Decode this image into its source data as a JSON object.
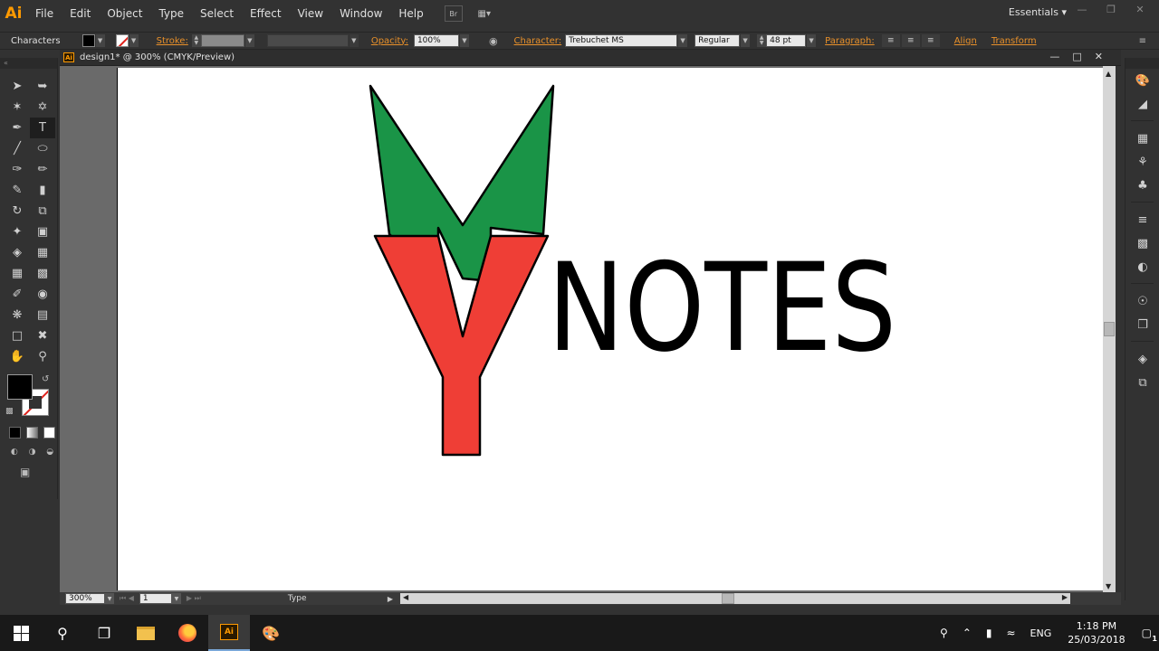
{
  "app": {
    "logo": "Ai"
  },
  "menu": {
    "items": [
      "File",
      "Edit",
      "Object",
      "Type",
      "Select",
      "Effect",
      "View",
      "Window",
      "Help"
    ],
    "bridge": "Br",
    "workspace": "Essentials"
  },
  "control": {
    "panel_label": "Characters",
    "stroke_label": "Stroke:",
    "opacity_label": "Opacity:",
    "opacity_value": "100%",
    "character_label": "Character:",
    "font_family": "Trebuchet MS",
    "font_style": "Regular",
    "font_size": "48 pt",
    "paragraph_label": "Paragraph:",
    "align_label": "Align",
    "transform_label": "Transform"
  },
  "document": {
    "title": "design1* @ 300% (CMYK/Preview)",
    "artwork_text": "NOTES",
    "colors": {
      "green": "#1a9447",
      "red": "#ef3e36"
    }
  },
  "status": {
    "zoom": "300%",
    "page": "1",
    "tool": "Type"
  },
  "taskbar": {
    "language": "ENG",
    "time": "1:18 PM",
    "date": "25/03/2018",
    "notifications": "1"
  }
}
